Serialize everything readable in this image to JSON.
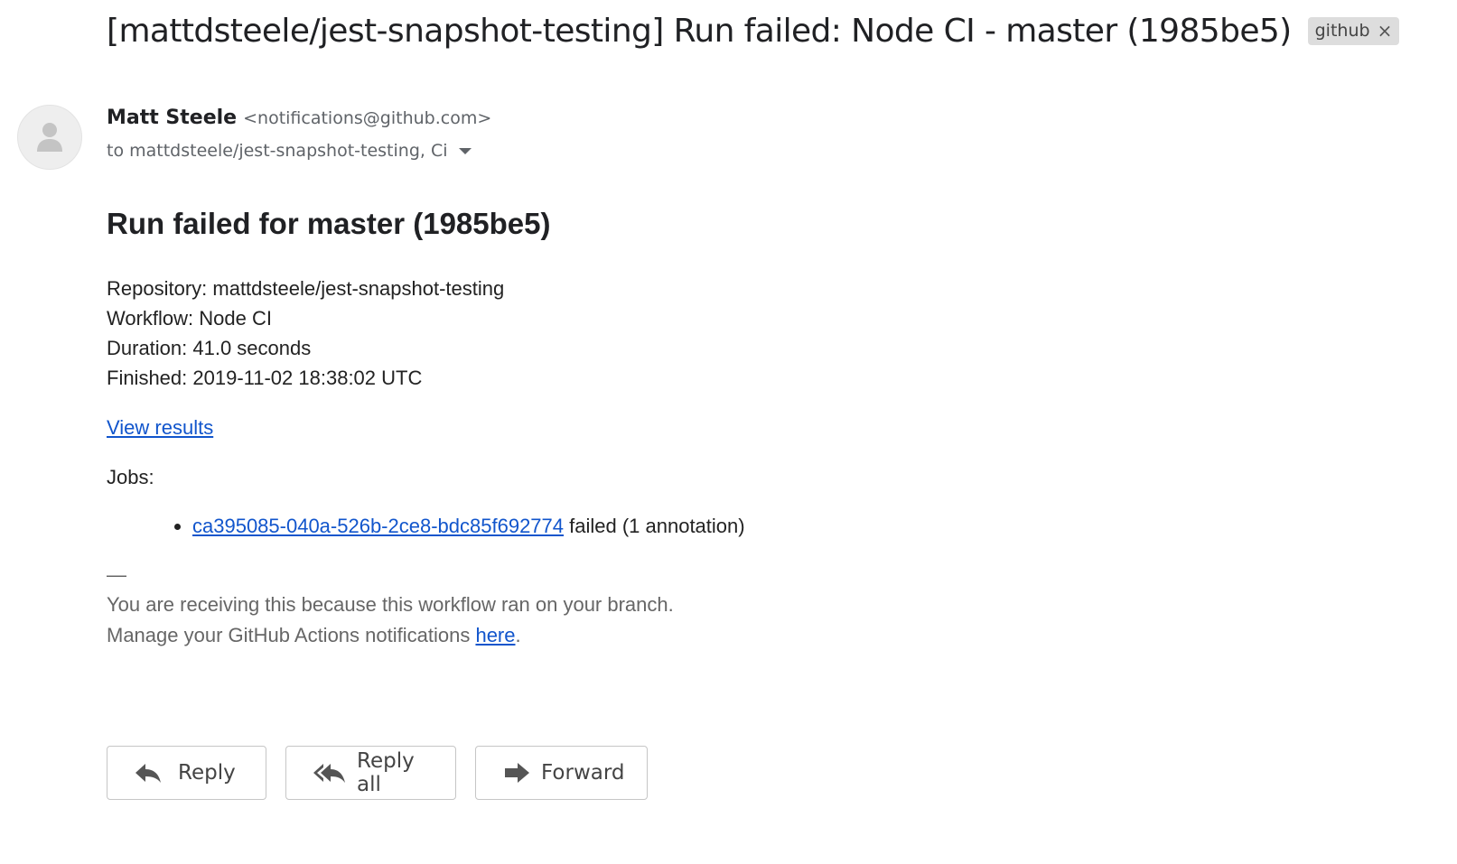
{
  "subject": "[mattdsteele/jest-snapshot-testing] Run failed: Node CI - master (1985be5)",
  "label_chip": {
    "text": "github",
    "close_glyph": "×"
  },
  "sender": {
    "name": "Matt Steele",
    "email": "<notifications@github.com>",
    "recipients": "to mattdsteele/jest-snapshot-testing, Ci"
  },
  "email_body": {
    "heading": "Run failed for master (1985be5)",
    "meta": [
      "Repository: mattdsteele/jest-snapshot-testing",
      "Workflow: Node CI",
      "Duration: 41.0 seconds",
      "Finished: 2019-11-02 18:38:02 UTC"
    ],
    "view_results_link": "View results",
    "jobs_label": "Jobs:",
    "jobs": [
      {
        "id_link": "ca395085-040a-526b-2ce8-bdc85f692774",
        "status": " failed (1 annotation)"
      }
    ],
    "footer_dash": "—",
    "footer_line1": "You are receiving this because this workflow ran on your branch.",
    "footer_line2_prefix": "Manage your GitHub Actions notifications ",
    "footer_line2_link": "here",
    "footer_line2_suffix": "."
  },
  "actions": {
    "reply": "Reply",
    "reply_all": "Reply all",
    "forward": "Forward"
  },
  "icons": {
    "avatar": "person-icon",
    "caret": "caret-down-icon",
    "reply": "reply-icon",
    "reply_all": "reply-all-icon",
    "forward": "forward-icon"
  },
  "colors": {
    "link": "#1155cc",
    "chip_bg": "#dddddd",
    "muted_text": "#5f6368",
    "footer_text": "#666666"
  }
}
